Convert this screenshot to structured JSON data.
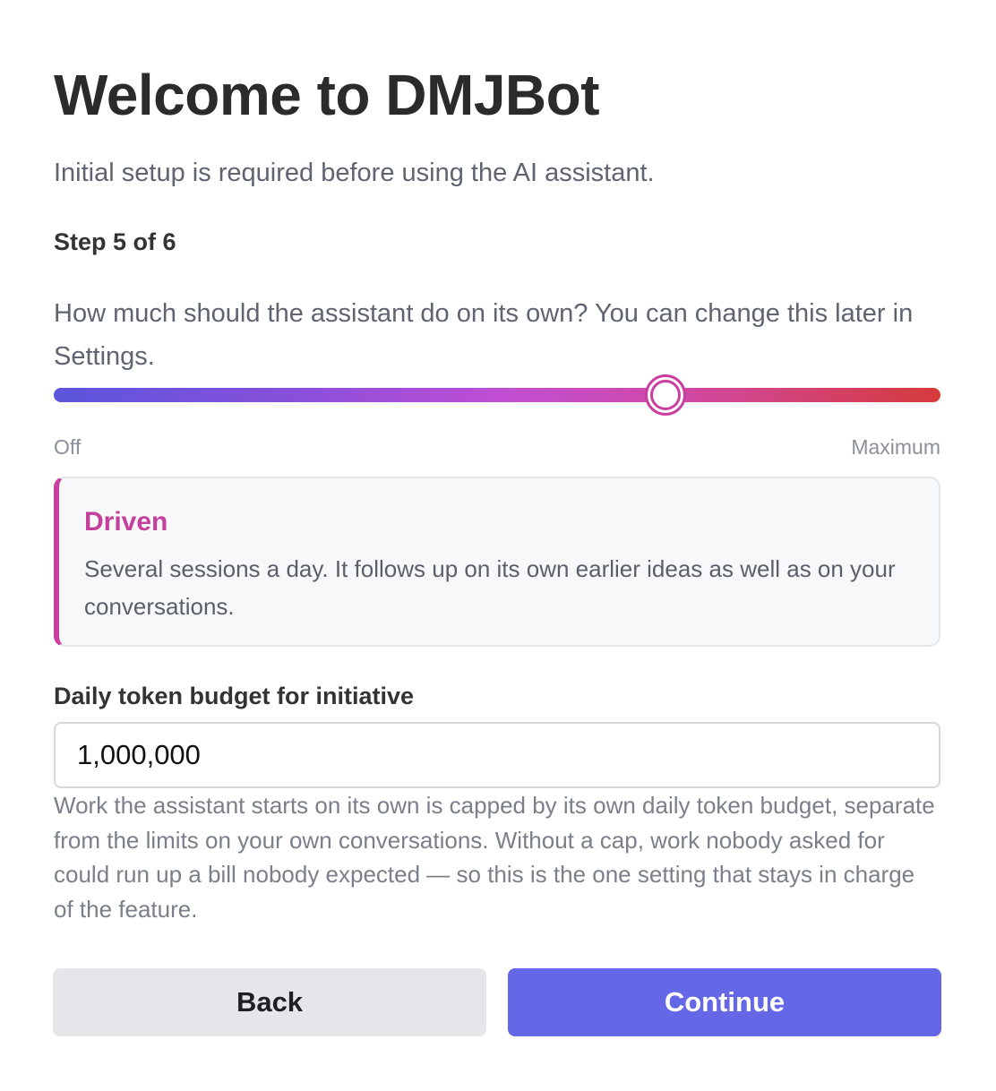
{
  "header": {
    "title": "Welcome to DMJBot",
    "subtitle": "Initial setup is required before using the AI assistant."
  },
  "progress": {
    "step_label": "Step 5 of 6",
    "current_step": 5,
    "total_steps": 6
  },
  "autonomy": {
    "question": "How much should the assistant do on its own? You can change this later in Settings.",
    "slider": {
      "min_label": "Off",
      "max_label": "Maximum",
      "value_fraction": 0.69,
      "gradient_colors": [
        "#5b55dc",
        "#8e4fda",
        "#c04ed4",
        "#d04aa8",
        "#d53a3a"
      ],
      "thumb_color": "#c93e9e"
    },
    "level": {
      "name": "Driven",
      "description": "Several sessions a day. It follows up on its own earlier ideas as well as on your conversations.",
      "accent_color": "#c93e9e"
    }
  },
  "budget": {
    "label": "Daily token budget for initiative",
    "value": "1,000,000",
    "help": "Work the assistant starts on its own is capped by its own daily token budget, separate from the limits on your own conversations. Without a cap, work nobody asked for could run up a bill nobody expected — so this is the one setting that stays in charge of the feature."
  },
  "actions": {
    "back_label": "Back",
    "continue_label": "Continue",
    "continue_color": "#6468e6"
  }
}
